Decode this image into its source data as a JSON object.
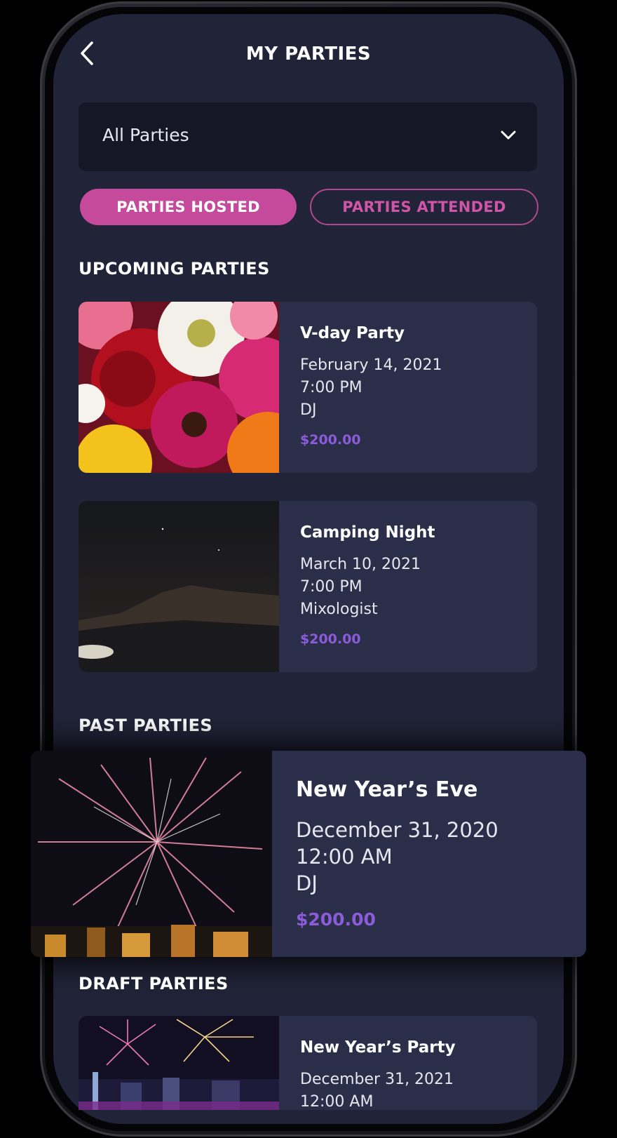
{
  "header": {
    "title": "MY PARTIES",
    "back_icon": "chevron-left-icon"
  },
  "filter": {
    "selected": "All Parties",
    "icon": "chevron-down-icon"
  },
  "tabs": [
    {
      "label": "PARTIES HOSTED",
      "active": true
    },
    {
      "label": "PARTIES ATTENDED",
      "active": false
    }
  ],
  "sections": {
    "upcoming": {
      "title": "UPCOMING PARTIES",
      "items": [
        {
          "name": "V-day Party",
          "date": "February 14, 2021",
          "time": "7:00 PM",
          "service": "DJ",
          "price": "$200.00",
          "image": "gerbera-flowers-photo"
        },
        {
          "name": "Camping Night",
          "date": "March 10, 2021",
          "time": "7:00 PM",
          "service": "Mixologist",
          "price": "$200.00",
          "image": "night-mountain-photo"
        }
      ]
    },
    "past": {
      "title": "PAST PARTIES",
      "items": [
        {
          "name": "New Year’s Eve",
          "date": "December  31, 2020",
          "time": "12:00 AM",
          "service": "DJ",
          "price": "$200.00",
          "image": "fireworks-city-photo"
        }
      ]
    },
    "draft": {
      "title": "DRAFT PARTIES",
      "items": [
        {
          "name": "New Year’s Party",
          "date": "December  31, 2021",
          "time": "12:00 AM",
          "image": "fireworks-skyline-photo"
        }
      ]
    }
  },
  "colors": {
    "screen_bg": "#212338",
    "card_bg": "#2b2e48",
    "accent_pink": "#c54a9c",
    "price_purple": "#8b5cd9",
    "dropdown_bg": "#161726"
  }
}
